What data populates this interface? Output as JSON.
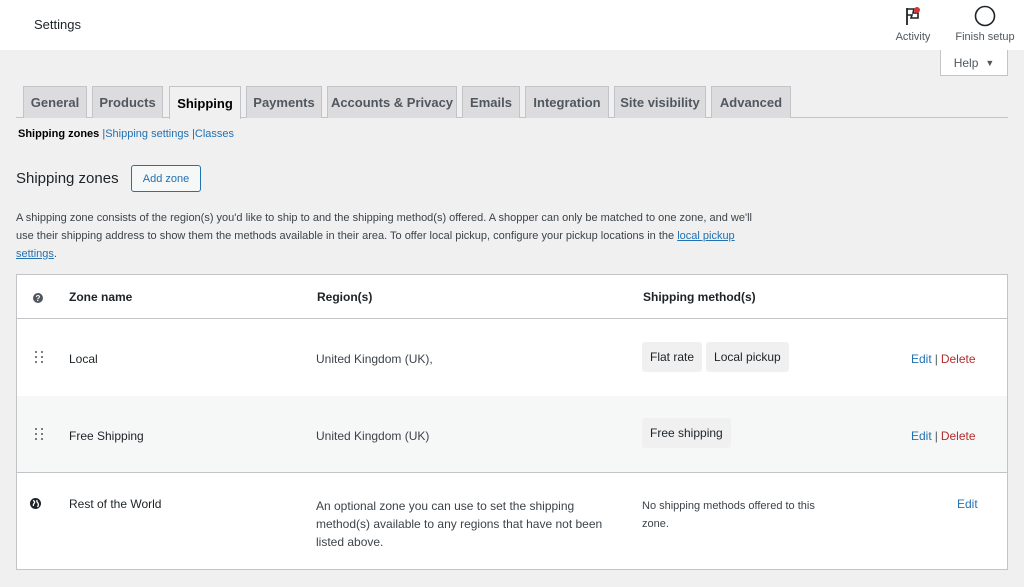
{
  "header": {
    "title": "Settings",
    "activity_label": "Activity",
    "finish_label": "Finish setup",
    "help_label": "Help",
    "colors": {
      "activity_dot": "#d63638"
    }
  },
  "tabs": [
    {
      "label": "General"
    },
    {
      "label": "Products"
    },
    {
      "label": "Shipping",
      "active": true
    },
    {
      "label": "Payments"
    },
    {
      "label": "Accounts & Privacy"
    },
    {
      "label": "Emails"
    },
    {
      "label": "Integration"
    },
    {
      "label": "Site visibility"
    },
    {
      "label": "Advanced"
    }
  ],
  "subnav": {
    "current": "Shipping zones",
    "settings": "Shipping settings",
    "classes": "Classes",
    "separator": "|"
  },
  "section": {
    "title": "Shipping zones",
    "add_zone": "Add zone",
    "desc_text": "A shipping zone consists of the region(s) you'd like to ship to and the shipping method(s) offered. A shopper can only be matched to one zone, and we'll use their shipping address to show them the methods available in their area. To offer local pickup, configure your pickup locations in the ",
    "desc_link": "local pickup settings",
    "desc_end": "."
  },
  "table": {
    "headers": {
      "name": "Zone name",
      "regions": "Region(s)",
      "methods": "Shipping method(s)"
    },
    "rows": [
      {
        "name": "Local",
        "region": "United Kingdom (UK),",
        "methods": [
          "Flat rate",
          "Local pickup"
        ],
        "edit": "Edit",
        "sep": "|",
        "delete": "Delete"
      },
      {
        "name": "Free Shipping",
        "region": "United Kingdom (UK)",
        "methods": [
          "Free shipping"
        ],
        "edit": "Edit",
        "sep": "|",
        "delete": "Delete"
      }
    ],
    "rest": {
      "name": "Rest of the World",
      "region": "An optional zone you can use to set the shipping method(s) available to any regions that have not been listed above.",
      "methods_text": "No shipping methods offered to this zone.",
      "edit": "Edit"
    }
  }
}
